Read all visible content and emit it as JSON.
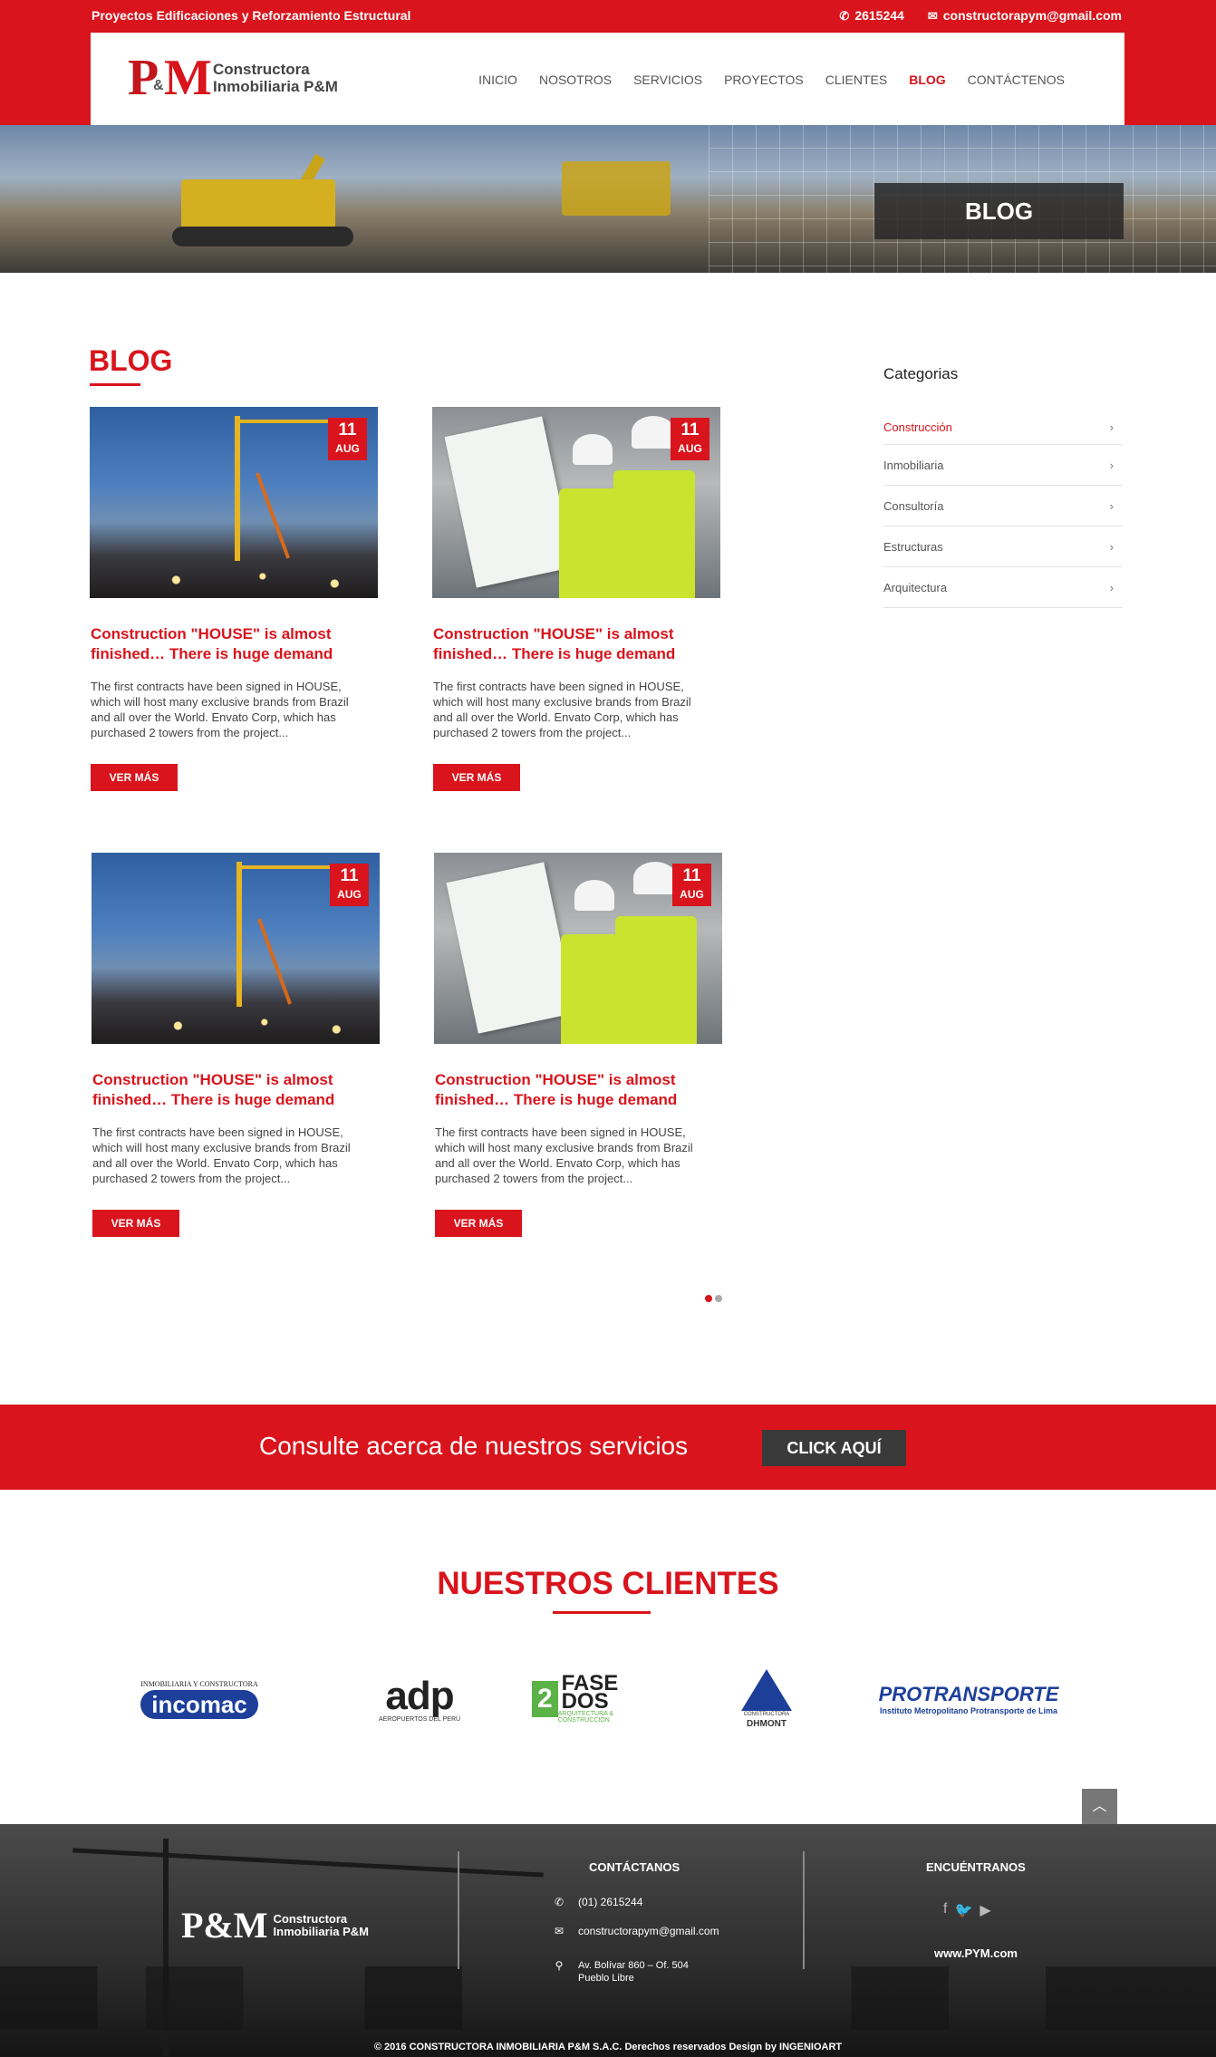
{
  "topbar": {
    "tagline": "Proyectos Edificaciones y Reforzamiento Estructural",
    "phone": "2615244",
    "email": "constructorapym@gmail.com"
  },
  "logo": {
    "mark_left": "P",
    "mark_amp": "&",
    "mark_right": "M",
    "line1": "Constructora",
    "line2": "Inmobiliaria P&M"
  },
  "nav": {
    "items": [
      "INICIO",
      "NOSOTROS",
      "SERVICIOS",
      "PROYECTOS",
      "CLIENTES",
      "BLOG",
      "CONTÁCTENOS"
    ],
    "active": "BLOG"
  },
  "hero": {
    "title": "BLOG"
  },
  "blog": {
    "heading": "BLOG",
    "posts": [
      {
        "day": "11",
        "month": "AUG",
        "title": "Construction \"HOUSE\" is almost finished… There is huge demand",
        "excerpt": "The first contracts have been signed in HOUSE, which will host many exclusive brands from Brazil and all over the World. Envato Corp, which has purchased 2 towers from the project...",
        "button": "VER MÁS"
      },
      {
        "day": "11",
        "month": "AUG",
        "title": "Construction \"HOUSE\" is almost finished… There is huge demand",
        "excerpt": "The first contracts have been signed in HOUSE, which will host many exclusive brands from Brazil and all over the World. Envato Corp, which has purchased 2 towers from the project...",
        "button": "VER MÁS"
      },
      {
        "day": "11",
        "month": "AUG",
        "title": "Construction \"HOUSE\" is almost finished… There is huge demand",
        "excerpt": "The first contracts have been signed in HOUSE, which will host many exclusive brands from Brazil and all over the World. Envato Corp, which has purchased 2 towers from the project...",
        "button": "VER MÁS"
      },
      {
        "day": "11",
        "month": "AUG",
        "title": "Construction \"HOUSE\" is almost finished… There is huge demand",
        "excerpt": "The first contracts have been signed in HOUSE, which will host many exclusive brands from Brazil and all over the World. Envato Corp, which has purchased 2 towers from the project...",
        "button": "VER MÁS"
      }
    ]
  },
  "sidebar": {
    "title": "Categorias",
    "categories": [
      "Construcción",
      "Inmobiliaria",
      "Consultoría",
      "Estructuras",
      "Arquitectura"
    ],
    "active": "Construcción"
  },
  "cta": {
    "text": "Consulte acerca de nuestros servicios",
    "button": "CLICK AQUÍ"
  },
  "clients": {
    "title": "NUESTROS CLIENTES",
    "incomac": {
      "small": "INMOBILIARIA Y CONSTRUCTORA",
      "name": "incomac"
    },
    "adp": {
      "name": "adp",
      "small": "AEROPUERTOS DEL PERÚ"
    },
    "fase": {
      "mark": "2",
      "line1": "FASE",
      "line2": "DOS",
      "sub": "ARQUITECTURA & CONSTRUCCIÓN"
    },
    "dhmont": {
      "small": "CONSTRUCTORA",
      "name": "DHMONT"
    },
    "protransporte": {
      "name": "PROTRANSPORTE",
      "sub": "Instituto Metropolitano Protransporte de Lima"
    }
  },
  "footer": {
    "logo_mark": "P&M",
    "logo_line1": "Constructora",
    "logo_line2": "Inmobiliaria P&M",
    "contact_title": "CONTÁCTANOS",
    "phone": "(01) 2615244",
    "email": "constructorapym@gmail.com",
    "address1": "Av. Bolívar 860 – Of. 504",
    "address2": "Pueblo Libre",
    "find_title": "ENCUÉNTRANOS",
    "www": "www.PYM.com",
    "copyright": "© 2016   CONSTRUCTORA INMOBILIARIA P&M S.A.C.   Derechos reservados Design by INGENIOART"
  },
  "colors": {
    "brand_red": "#d9141c",
    "dark": "#3a3a3a"
  },
  "icons": [
    "phone-icon",
    "envelope-icon",
    "map-pin-icon",
    "facebook-icon",
    "twitter-icon",
    "youtube-icon",
    "chevron-right-icon",
    "chevron-up-icon"
  ]
}
